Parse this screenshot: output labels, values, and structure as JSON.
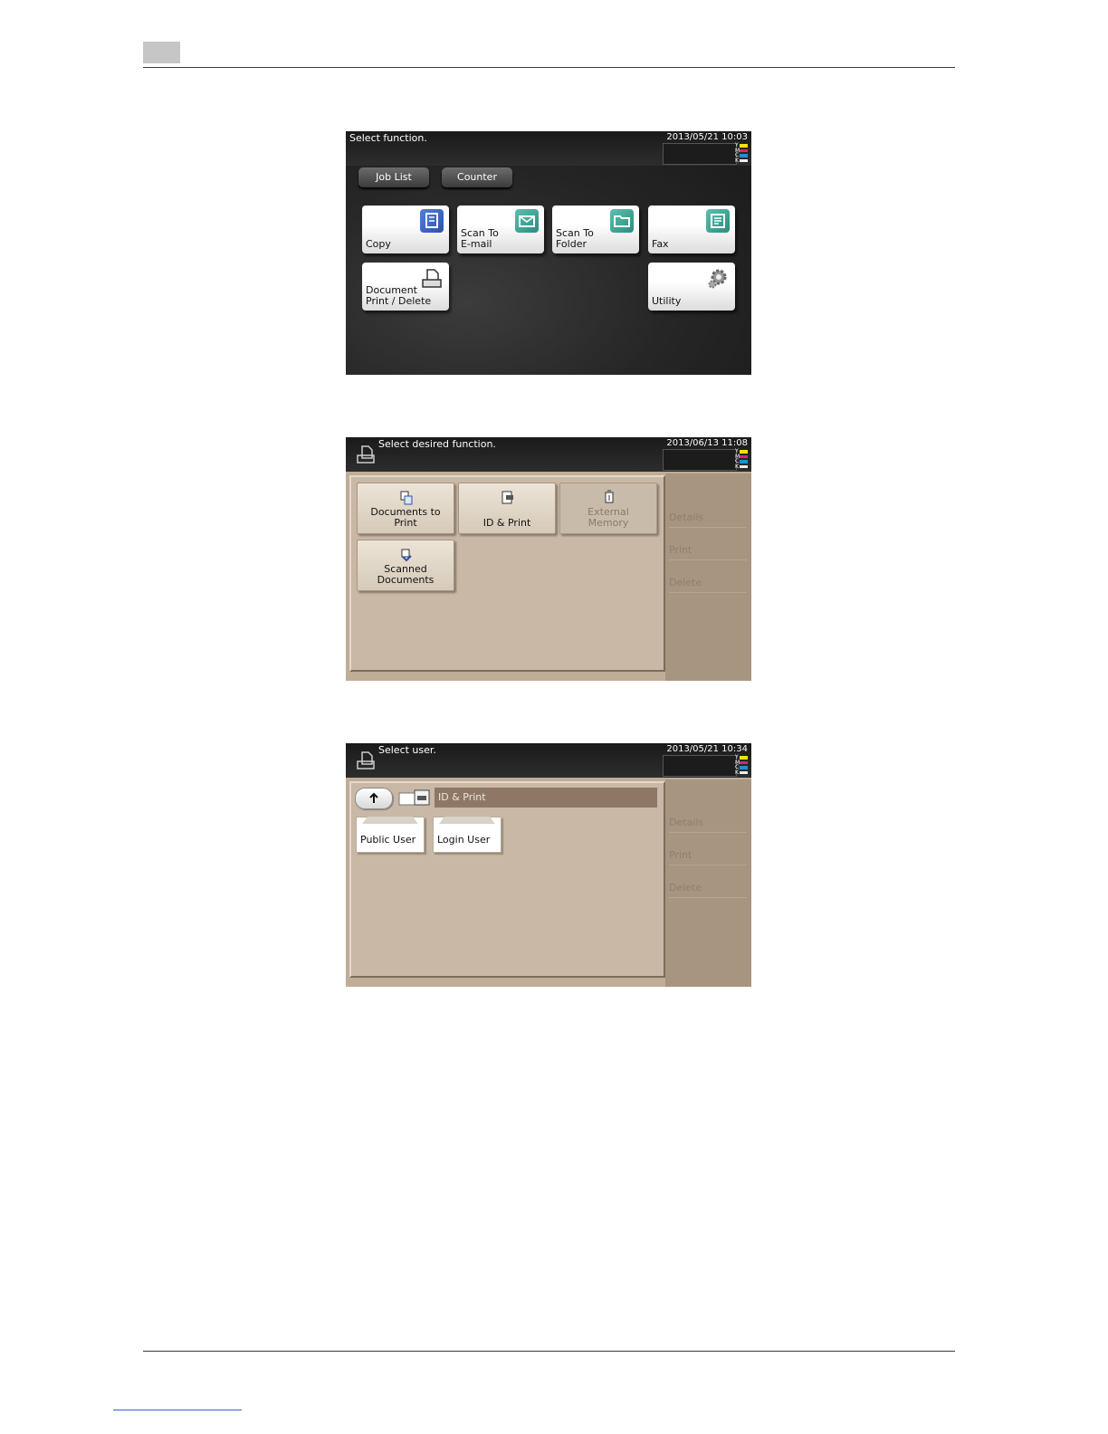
{
  "screen1": {
    "message": "Select function.",
    "datetime": "2013/05/21 10:03",
    "toner": [
      "Y",
      "M",
      "C",
      "K"
    ],
    "buttons": {
      "job_list": "Job List",
      "counter": "Counter"
    },
    "tiles": [
      {
        "label": "Copy",
        "icon": "copy-icon"
      },
      {
        "label": "Scan To\nE-mail",
        "icon": "envelope-icon"
      },
      {
        "label": "Scan To\nFolder",
        "icon": "folder-icon"
      },
      {
        "label": "Fax",
        "icon": "fax-icon"
      },
      {
        "label": "Document\nPrint / Delete",
        "icon": "document-print-icon"
      },
      {
        "label": "Utility",
        "icon": "gear-icon"
      }
    ]
  },
  "screen2": {
    "message": "Select desired function.",
    "datetime": "2013/06/13 11:08",
    "toner": [
      "Y",
      "M",
      "C",
      "K"
    ],
    "buttons": [
      {
        "label": "Documents to Print",
        "icon": "documents-to-print-icon"
      },
      {
        "label": "ID & Print",
        "icon": "id-print-icon"
      },
      {
        "label": "External\nMemory",
        "icon": "usb-memory-icon"
      },
      {
        "label": "Scanned\nDocuments",
        "icon": "scanned-documents-icon"
      }
    ],
    "side": {
      "details": "Details",
      "print": "Print",
      "delete": "Delete"
    }
  },
  "screen3": {
    "message": "Select user.",
    "datetime": "2013/05/21 10:34",
    "toner": [
      "Y",
      "M",
      "C",
      "K"
    ],
    "path": "ID & Print",
    "users": [
      "Public User",
      "Login User"
    ],
    "side": {
      "details": "Details",
      "print": "Print",
      "delete": "Delete"
    }
  },
  "colors": {
    "toner_y": "#f2e40a",
    "toner_m": "#d8256e",
    "toner_c": "#1e8fd8",
    "toner_k": "#eeeeee",
    "panel_beige": "#c0ad97",
    "panel_dark": "#262626"
  }
}
